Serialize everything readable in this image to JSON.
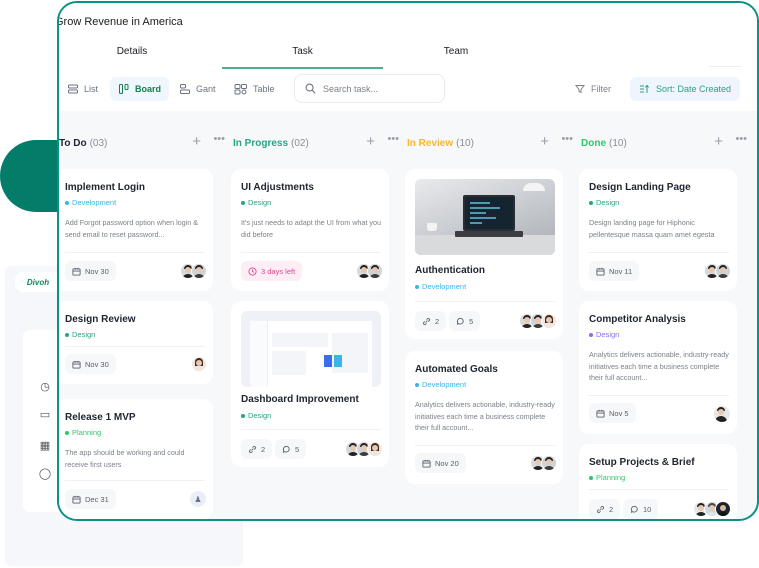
{
  "background": {
    "logo_text": "Divoh",
    "sidebar_icons": [
      "clock-icon",
      "video-icon",
      "calendar-icon",
      "globe-icon"
    ]
  },
  "project": {
    "title": "Grow Revenue in America"
  },
  "tabs": [
    {
      "label": "Details",
      "active": false
    },
    {
      "label": "Task",
      "active": true
    },
    {
      "label": "Team",
      "active": false
    }
  ],
  "views": [
    {
      "label": "List",
      "icon": "list-icon",
      "active": false
    },
    {
      "label": "Board",
      "icon": "board-icon",
      "active": true
    },
    {
      "label": "Gant",
      "icon": "gantt-icon",
      "active": false
    },
    {
      "label": "Table",
      "icon": "table-icon",
      "active": false
    }
  ],
  "search": {
    "placeholder": "Search task...",
    "value": ""
  },
  "toolbar": {
    "filter_label": "Filter",
    "sort_label": "Sort: Date Created"
  },
  "colors": {
    "accent": "#0a9384",
    "todo": "#1e2430",
    "in_progress": "#2aa383",
    "in_review": "#f5b731",
    "done": "#35c46a",
    "tag_development": "#38b6e8",
    "tag_design_green": "#2aa383",
    "tag_design_purple": "#8b6cf0",
    "tag_planning": "#35c46a",
    "due_pink": "#e1468c"
  },
  "columns": [
    {
      "title": "To Do",
      "count": "(03)",
      "color": "#1e2430",
      "cards": [
        {
          "title": "Implement Login",
          "tag": "Development",
          "tag_color": "#38b6e8",
          "description": "Add Forgot password option when login & send email to reset password...",
          "date": "Nov 30",
          "avatars": 2
        },
        {
          "title": "Design Review",
          "tag": "Design",
          "tag_color": "#2aa383",
          "description": "",
          "date": "Nov 30",
          "avatars": 1
        },
        {
          "title": "Release 1 MVP",
          "tag": "Planning",
          "tag_color": "#35c46a",
          "description": "The app should be working and could receive first users",
          "date": "Dec 31",
          "avatars": 0
        }
      ]
    },
    {
      "title": "In Progress",
      "count": "(02)",
      "color": "#2aa383",
      "cards": [
        {
          "title": "UI Adjustments",
          "tag": "Design",
          "tag_color": "#2aa383",
          "description": "It's just needs to adapt the UI from what you did before",
          "due": "3 days left",
          "avatars": 2
        },
        {
          "title": "Dashboard Improvement",
          "tag": "Design",
          "tag_color": "#2aa383",
          "image": "dashboard-screenshot",
          "links": "2",
          "comments": "5",
          "avatars": 3
        }
      ]
    },
    {
      "title": "In Review",
      "count": "(10)",
      "color": "#f5b731",
      "cards": [
        {
          "title": "Authentication",
          "tag": "Development",
          "tag_color": "#38b6e8",
          "image": "laptop-photo",
          "links": "2",
          "comments": "5",
          "avatars": 3
        },
        {
          "title": "Automated Goals",
          "tag": "Development",
          "tag_color": "#38b6e8",
          "description": "Analytics delivers actionable, industry-ready initiatives each time a business complete their full account...",
          "date": "Nov 20",
          "avatars": 2
        }
      ]
    },
    {
      "title": "Done",
      "count": "(10)",
      "color": "#35c46a",
      "cards": [
        {
          "title": "Design Landing Page",
          "tag": "Design",
          "tag_color": "#2aa383",
          "description": "Design landing page for Hiphonic pellentesque massa quam amet egesta",
          "date": "Nov 11",
          "avatars": 2
        },
        {
          "title": "Competitor Analysis",
          "tag": "Design",
          "tag_color": "#8b6cf0",
          "description": "Analytics delivers actionable, industry-ready initiatives each time a business complete their full account...",
          "date": "Nov 5",
          "avatars": 1
        },
        {
          "title": "Setup Projects & Brief",
          "tag": "Planning",
          "tag_color": "#35c46a",
          "links": "2",
          "comments": "10",
          "avatars": 3
        }
      ]
    }
  ]
}
